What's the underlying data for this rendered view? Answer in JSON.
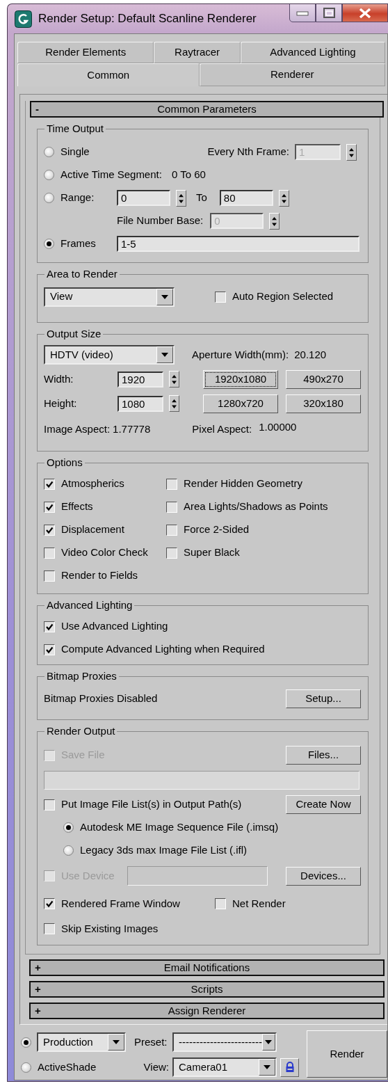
{
  "window": {
    "title": "Render Setup: Default Scanline Renderer"
  },
  "tab_rows": [
    [
      {
        "label": "Render Elements",
        "selected": false
      },
      {
        "label": "Raytracer",
        "selected": false
      },
      {
        "label": "Advanced Lighting",
        "selected": false
      }
    ],
    [
      {
        "label": "Common",
        "selected": true
      },
      {
        "label": "Renderer",
        "selected": false
      }
    ]
  ],
  "rollouts": [
    {
      "symbol": "-",
      "title": "Common Parameters",
      "expanded": true,
      "time_output": {
        "title": "Time Output",
        "options": [
          {
            "label": "Single",
            "selected": false
          },
          {
            "label": "Active Time Segment:",
            "selected": false
          },
          {
            "label": "Range:",
            "selected": false
          },
          {
            "label": "Frames",
            "selected": true
          }
        ],
        "every_nth_frame": {
          "label": "Every Nth Frame:",
          "value": "1",
          "disabled": true
        },
        "active_segment": "0 To 60",
        "range_start": {
          "value": "0",
          "disabled": false
        },
        "range_to": "To",
        "range_end": {
          "value": "80",
          "disabled": false
        },
        "file_number_base": {
          "label": "File Number Base:",
          "value": "0",
          "disabled": true
        },
        "frames": {
          "value": "1-5",
          "disabled": false
        }
      },
      "area_to_render": {
        "title": "Area to Render",
        "dropdown": {
          "value": "View"
        },
        "auto_region": {
          "label": "Auto Region Selected",
          "checked": false,
          "disabled": false
        }
      },
      "output_size": {
        "title": "Output Size",
        "preset": {
          "value": "HDTV (video)"
        },
        "aperture": {
          "label": "Aperture Width(mm):",
          "value": "20.120"
        },
        "width": {
          "label": "Width:",
          "value": "1920",
          "disabled": false
        },
        "height": {
          "label": "Height:",
          "value": "1080",
          "disabled": false
        },
        "presets": [
          {
            "label": "1920x1080",
            "focused": true
          },
          {
            "label": "490x270",
            "focused": false
          },
          {
            "label": "1280x720",
            "focused": false
          },
          {
            "label": "320x180",
            "focused": false
          }
        ],
        "image_aspect": {
          "label": "Image Aspect:",
          "value": "1.77778"
        },
        "pixel_aspect": {
          "label": "Pixel Aspect:",
          "value": "1.00000"
        }
      },
      "options": {
        "title": "Options",
        "items": [
          {
            "label": "Atmospherics",
            "checked": true,
            "disabled": false
          },
          {
            "label": "Render Hidden Geometry",
            "checked": false,
            "disabled": false
          },
          {
            "label": "Effects",
            "checked": true,
            "disabled": false
          },
          {
            "label": "Area Lights/Shadows as Points",
            "checked": false,
            "disabled": false
          },
          {
            "label": "Displacement",
            "checked": true,
            "disabled": false
          },
          {
            "label": "Force 2-Sided",
            "checked": false,
            "disabled": false
          },
          {
            "label": "Video Color Check",
            "checked": false,
            "disabled": false
          },
          {
            "label": "Super Black",
            "checked": false,
            "disabled": false
          },
          {
            "label": "Render to Fields",
            "checked": false,
            "disabled": false
          }
        ]
      },
      "advanced_lighting": {
        "title": "Advanced Lighting",
        "items": [
          {
            "label": "Use Advanced Lighting",
            "checked": true,
            "disabled": false
          },
          {
            "label": "Compute Advanced Lighting when Required",
            "checked": true,
            "disabled": false
          }
        ]
      },
      "bitmap_proxies": {
        "title": "Bitmap Proxies",
        "status": "Bitmap Proxies Disabled",
        "button": "Setup..."
      },
      "render_output": {
        "title": "Render Output",
        "save_file": {
          "label": "Save File",
          "checked": false,
          "disabled": true
        },
        "files_button": "Files...",
        "put_image_list": {
          "label": "Put Image File List(s) in Output Path(s)",
          "checked": false,
          "disabled": false
        },
        "create_now_button": "Create Now",
        "list_formats": [
          {
            "label": "Autodesk ME Image Sequence File (.imsq)",
            "selected": true
          },
          {
            "label": "Legacy 3ds max Image File List (.ifl)",
            "selected": false
          }
        ],
        "use_device": {
          "label": "Use Device",
          "checked": false,
          "disabled": true
        },
        "devices_button": "Devices...",
        "rendered_frame_window": {
          "label": "Rendered Frame Window",
          "checked": true,
          "disabled": false
        },
        "net_render": {
          "label": "Net Render",
          "checked": false,
          "disabled": false
        },
        "skip_existing": {
          "label": "Skip Existing Images",
          "checked": false,
          "disabled": false
        }
      }
    },
    {
      "symbol": "+",
      "title": "Email Notifications",
      "expanded": false
    },
    {
      "symbol": "+",
      "title": "Scripts",
      "expanded": false
    },
    {
      "symbol": "+",
      "title": "Assign Renderer",
      "expanded": false
    }
  ],
  "footer": {
    "modes": [
      {
        "kind": "dropdown",
        "value": "Production",
        "selected": true
      },
      {
        "kind": "label",
        "label": "ActiveShade",
        "selected": false
      }
    ],
    "preset": {
      "label": "Preset:",
      "value": "------------------------"
    },
    "view": {
      "label": "View:",
      "value": "Camera01"
    },
    "render_button": "Render"
  }
}
